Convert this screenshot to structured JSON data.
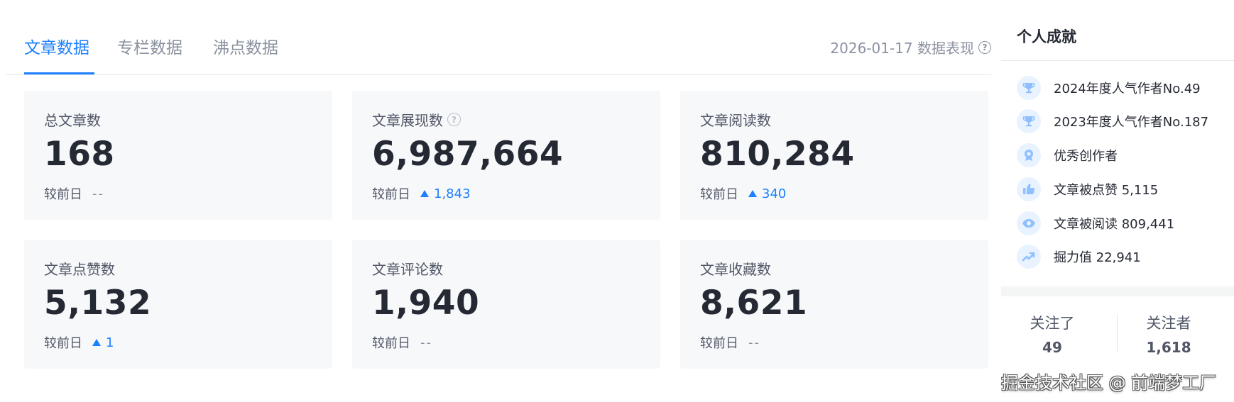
{
  "tabs": [
    {
      "label": "文章数据",
      "active": true
    },
    {
      "label": "专栏数据",
      "active": false
    },
    {
      "label": "沸点数据",
      "active": false
    }
  ],
  "date_performance": "2026-01-17 数据表现",
  "compare_label": "较前日",
  "cards": [
    {
      "title": "总文章数",
      "value": "168",
      "delta": "--",
      "trend": "none"
    },
    {
      "title": "文章展现数",
      "value": "6,987,664",
      "delta": "1,843",
      "trend": "up",
      "help_icon": "help-icon"
    },
    {
      "title": "文章阅读数",
      "value": "810,284",
      "delta": "340",
      "trend": "up"
    },
    {
      "title": "文章点赞数",
      "value": "5,132",
      "delta": "1",
      "trend": "up"
    },
    {
      "title": "文章评论数",
      "value": "1,940",
      "delta": "--",
      "trend": "none"
    },
    {
      "title": "文章收藏数",
      "value": "8,621",
      "delta": "--",
      "trend": "none"
    }
  ],
  "achievements": {
    "title": "个人成就",
    "items": [
      {
        "icon": "trophy-icon",
        "label": "2024年度人气作者No.49"
      },
      {
        "icon": "trophy-icon",
        "label": "2023年度人气作者No.187"
      },
      {
        "icon": "badge-icon",
        "label": "优秀创作者"
      },
      {
        "icon": "thumbs-up-icon",
        "label": "文章被点赞 5,115"
      },
      {
        "icon": "eye-icon",
        "label": "文章被阅读 809,441"
      },
      {
        "icon": "trend-up-icon",
        "label": "掘力值 22,941"
      }
    ]
  },
  "follow": {
    "following_label": "关注了",
    "following_count": "49",
    "followers_label": "关注者",
    "followers_count": "1,618"
  },
  "watermark": "掘金技术社区 @ 前端梦工厂",
  "colors": {
    "accent": "#1e80ff",
    "card_bg": "#f7f8fa",
    "icon_bg": "#e8f3ff",
    "muted_text": "#8a919f"
  }
}
